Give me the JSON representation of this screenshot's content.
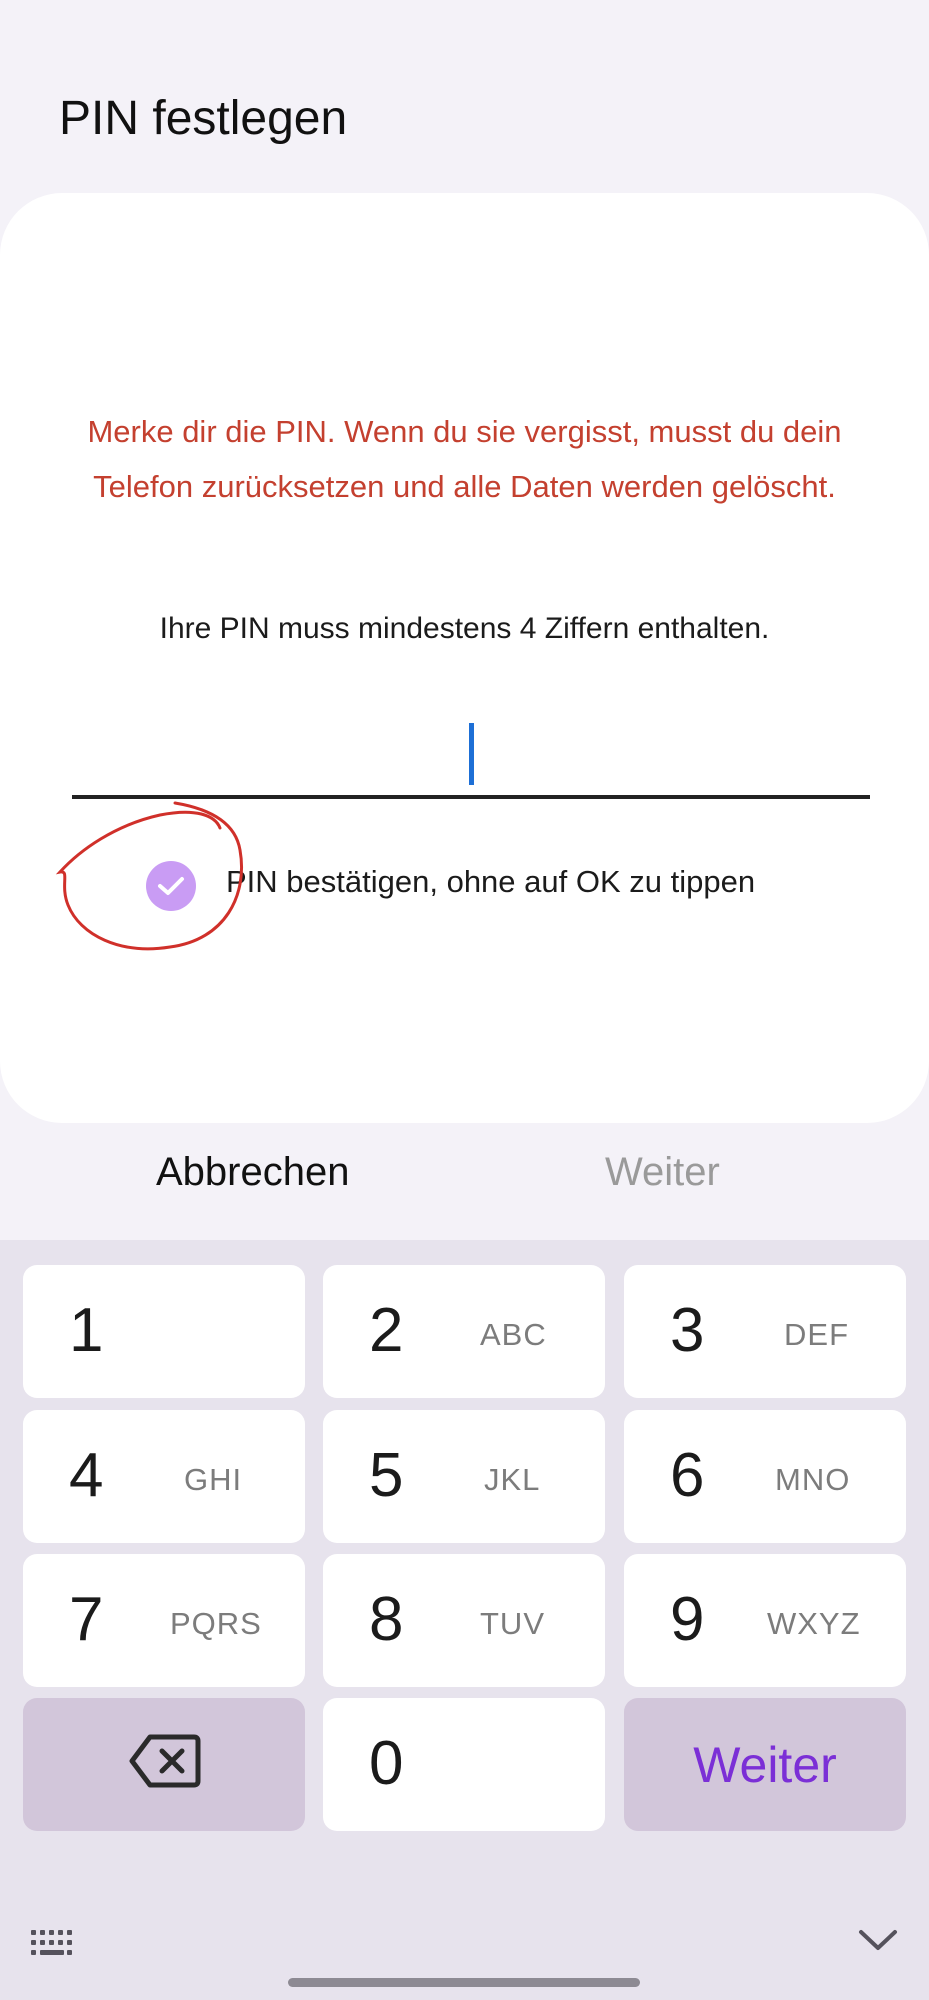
{
  "header": {
    "title": "PIN festlegen"
  },
  "card": {
    "warning": "Merke dir die PIN. Wenn du sie vergisst, musst du dein Telefon zurücksetzen und alle Daten werden gelöscht.",
    "info": "Ihre PIN muss mindestens 4 Ziffern enthalten.",
    "pin_value": "",
    "confirm_checkbox": {
      "label": "PIN bestätigen, ohne auf OK zu tippen",
      "checked": true
    }
  },
  "actions": {
    "cancel": "Abbrechen",
    "next": "Weiter"
  },
  "keypad": {
    "keys": [
      {
        "num": "1",
        "letters": ""
      },
      {
        "num": "2",
        "letters": "ABC"
      },
      {
        "num": "3",
        "letters": "DEF"
      },
      {
        "num": "4",
        "letters": "GHI"
      },
      {
        "num": "5",
        "letters": "JKL"
      },
      {
        "num": "6",
        "letters": "MNO"
      },
      {
        "num": "7",
        "letters": "PQRS"
      },
      {
        "num": "8",
        "letters": "TUV"
      },
      {
        "num": "9",
        "letters": "WXYZ"
      },
      {
        "num": "0",
        "letters": ""
      }
    ],
    "enter_label": "Weiter",
    "backspace_icon": "backspace-icon"
  },
  "colors": {
    "warning": "#c4402f",
    "accent": "#7b2fd6",
    "checkbox": "#c99cf4",
    "annotation": "#d0302a"
  }
}
